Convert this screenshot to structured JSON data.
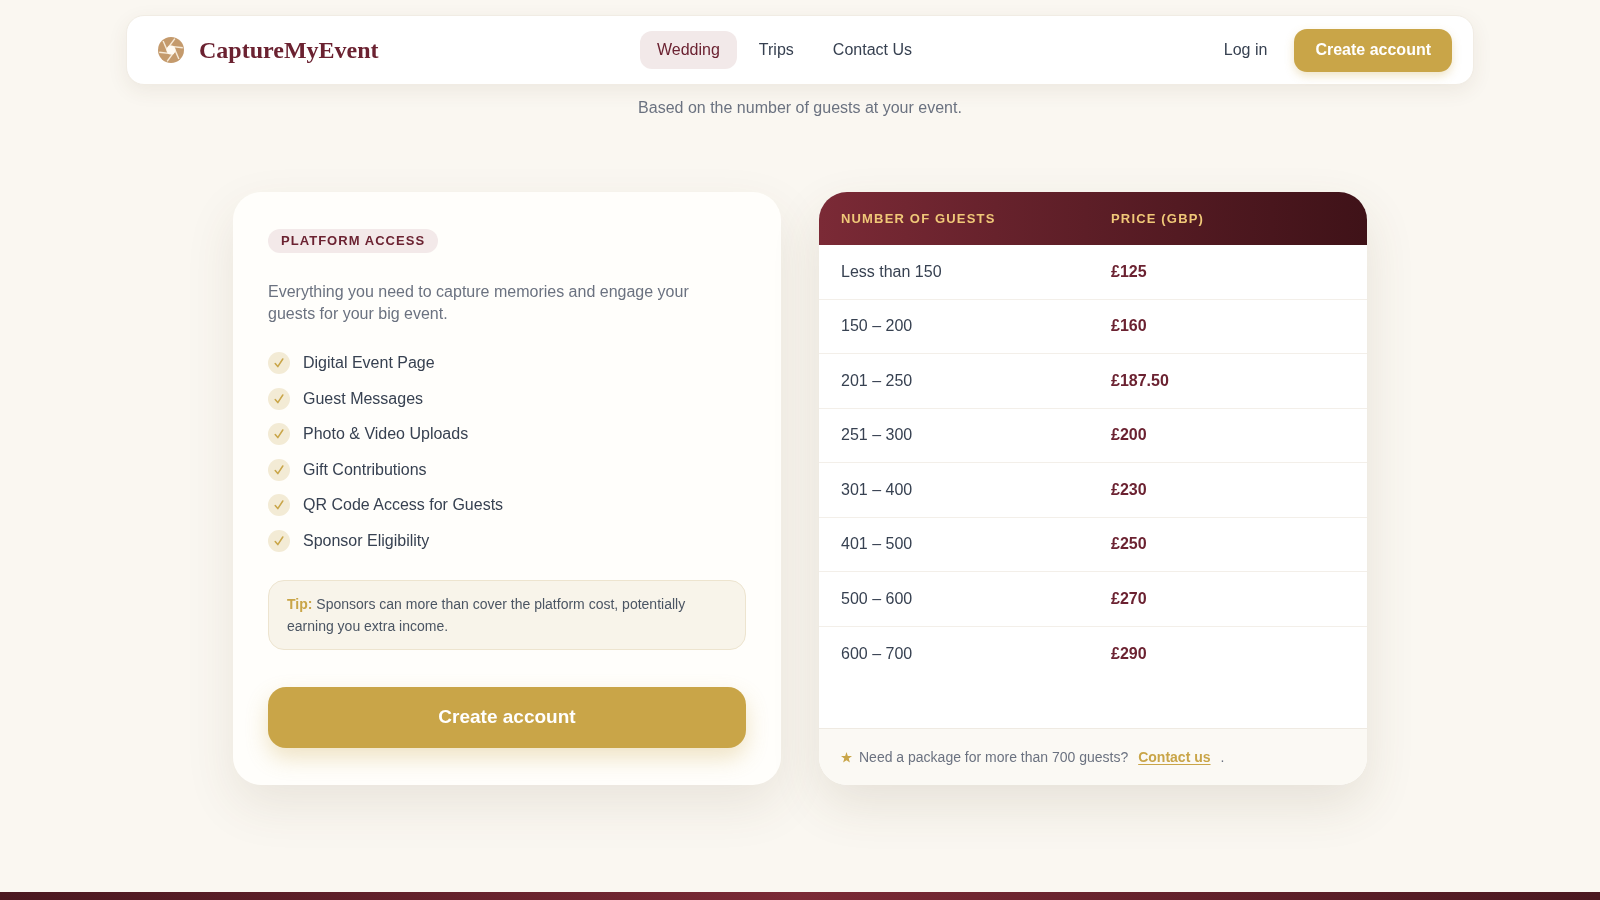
{
  "header": {
    "brand": "CaptureMyEvent",
    "nav": [
      {
        "label": "Wedding",
        "selected": true
      },
      {
        "label": "Trips",
        "selected": false
      },
      {
        "label": "Contact Us",
        "selected": false
      }
    ],
    "login": "Log in",
    "cta": "Create account"
  },
  "subtitle": "Based on the number of guests at your event.",
  "plan_card": {
    "badge": "PLATFORM ACCESS",
    "description": "Everything you need to capture memories and engage your guests for your big event.",
    "features": [
      "Digital Event Page",
      "Guest Messages",
      "Photo & Video Uploads",
      "Gift Contributions",
      "QR Code Access for Guests",
      "Sponsor Eligibility"
    ],
    "tip": "**Tip:** Sponsors can more than cover the platform cost, potentially earning you extra income.",
    "button": "Create account"
  },
  "price_table": {
    "columns": [
      "NUMBER OF GUESTS",
      "PRICE (GBP)"
    ],
    "rows": [
      {
        "guests": "Less than 150",
        "price": "£125"
      },
      {
        "guests": "150 – 200",
        "price": "£160"
      },
      {
        "guests": "201 – 250",
        "price": "£187.50"
      },
      {
        "guests": "251 – 300",
        "price": "£200"
      },
      {
        "guests": "301 – 400",
        "price": "£230"
      },
      {
        "guests": "401 – 500",
        "price": "£250"
      },
      {
        "guests": "500 – 600",
        "price": "£270"
      },
      {
        "guests": "600 – 700",
        "price": "£290"
      }
    ],
    "footer": {
      "text": "Need a package for more than 700 guests?",
      "link": "Contact us",
      "end": "."
    }
  }
}
